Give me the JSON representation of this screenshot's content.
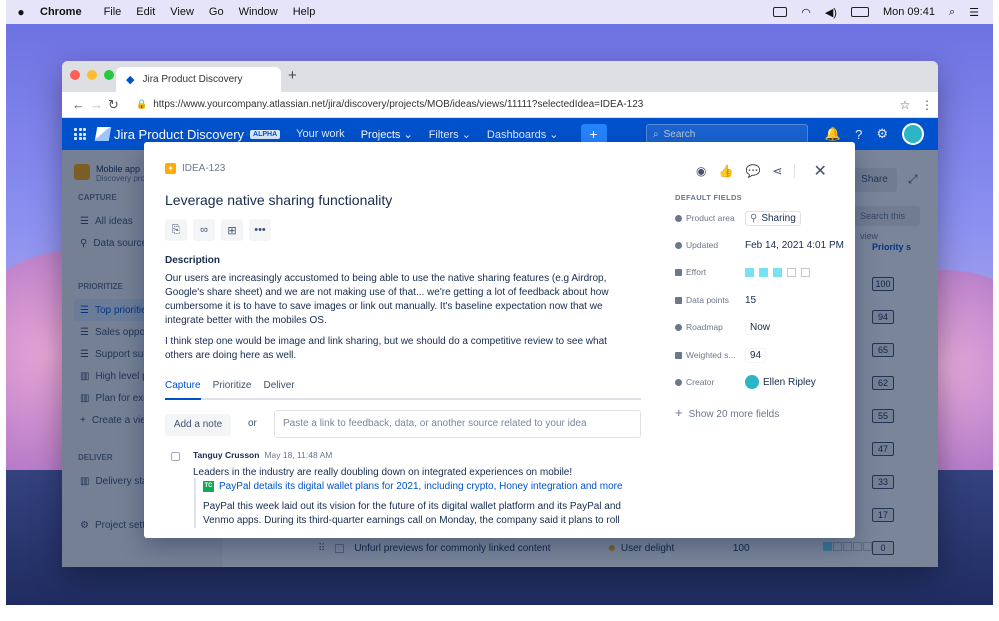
{
  "menubar": {
    "app": "Chrome",
    "items": [
      "File",
      "Edit",
      "View",
      "Go",
      "Window",
      "Help"
    ],
    "clock": "Mon 09:41"
  },
  "browser": {
    "tab_title": "Jira Product Discovery",
    "url": "https://www.yourcompany.atlassian.net/jira/discovery/projects/MOB/ideas/views/11111?selectedIdea=IDEA-123"
  },
  "jira": {
    "title": "Jira Product Discovery",
    "badge": "ALPHA",
    "nav": [
      "Your work",
      "Projects ⌄",
      "Filters ⌄",
      "Dashboards ⌄"
    ],
    "create": "+",
    "search_placeholder": "Search"
  },
  "sidebar": {
    "project": "Mobile app",
    "project_sub": "Discovery project",
    "capture_label": "CAPTURE",
    "capture_items": [
      "All ideas",
      "Data sources"
    ],
    "prioritize_label": "PRIORITIZE",
    "prioritize_items": [
      "Top priorities",
      "Sales opportunities",
      "Support suggestions",
      "High level plan",
      "Plan for execution",
      "Create a view"
    ],
    "deliver_label": "DELIVER",
    "deliver_items": [
      "Delivery status"
    ],
    "settings": "Project settings"
  },
  "list": {
    "share": "Share",
    "search_placeholder": "Search this view",
    "priority_header": "Priority s",
    "scores": [
      "100",
      "94",
      "65",
      "62",
      "55",
      "47",
      "33",
      "17",
      "0"
    ],
    "bottom_row": {
      "title": "Unfurl previews for commonly linked content",
      "tag": "User delight",
      "value": "100"
    }
  },
  "modal": {
    "key": "IDEA-123",
    "title": "Leverage native sharing functionality",
    "description_label": "Description",
    "description": [
      "Our users are increasingly accustomed to being able to use the native sharing features (e.g Airdrop, Google's share sheet) and we are not making use of that... we're getting a lot of feedback about how cumbersome it is to have to save images or link out manually. It's baseline expectation now that we integrate better with the mobiles OS.",
      "I think step one would be image and link sharing, but we should do a competitive review to see what others are doing here as well."
    ],
    "tabs": [
      "Capture",
      "Prioritize",
      "Deliver"
    ],
    "add_note": "Add a note",
    "or": "or",
    "paste_placeholder": "Paste a link to feedback, data, or another source related to your idea",
    "note": {
      "author": "Tanguy Crusson",
      "date": "May 18, 11:48 AM",
      "text": "Leaders in the industry are really doubling down on integrated experiences on mobile!",
      "link_badge": "TC",
      "link": "PayPal details its digital wallet plans for 2021, including crypto, Honey integration and more",
      "excerpt": "PayPal this week laid out its vision for the future of its digital wallet platform and its PayPal and Venmo apps. During its third-quarter earnings call on Monday, the company said it plans to roll"
    },
    "fields_header": "DEFAULT FIELDS",
    "fields": [
      {
        "label": "Product area",
        "value": "Sharing"
      },
      {
        "label": "Updated",
        "value": "Feb 14, 2021 4:01 PM"
      },
      {
        "label": "Effort",
        "value": "3 of 5",
        "level": 3
      },
      {
        "label": "Data points",
        "value": "15"
      },
      {
        "label": "Roadmap",
        "value": "Now"
      },
      {
        "label": "Weighted s...",
        "value": "94"
      },
      {
        "label": "Creator",
        "value": "Ellen Ripley"
      }
    ],
    "show_more": "Show 20 more fields"
  },
  "colors": {
    "jira_blue": "#0052CC",
    "effort_fill": "#79E2F2",
    "idea_yellow": "#FFAB00"
  }
}
